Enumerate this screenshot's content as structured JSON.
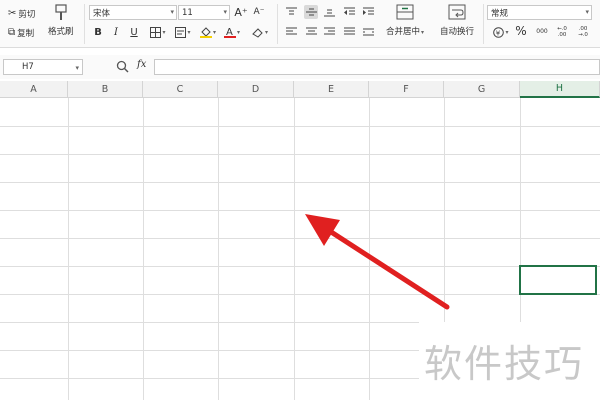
{
  "ribbon": {
    "clipboard": {
      "cut": "剪切",
      "copy": "复制",
      "format_painter": "格式刷"
    },
    "font": {
      "name": "宋体",
      "size": "11",
      "grow": "A⁺",
      "shrink": "A⁻",
      "bold": "B",
      "italic": "I",
      "underline": "U"
    },
    "align": {
      "merge_center": "合并居中",
      "wrap_text": "自动换行"
    },
    "number": {
      "format": "常规",
      "percent": "%",
      "thousands": "000",
      "inc_dec": "←.0 .00",
      "dec_dec": ".00 →.0"
    }
  },
  "formula_bar": {
    "name_box": "H7",
    "fx": "fx",
    "value": ""
  },
  "sheet": {
    "columns": [
      "A",
      "B",
      "C",
      "D",
      "E",
      "F",
      "G",
      "H"
    ],
    "selected_column": "H",
    "selected_cell": "H7"
  },
  "watermark": "软件技巧",
  "colors": {
    "accent": "#217346",
    "arrow": "#e02020"
  }
}
